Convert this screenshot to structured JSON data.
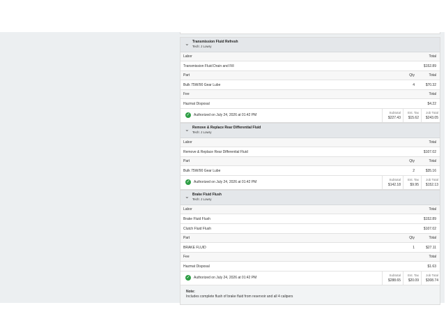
{
  "jobs": [
    {
      "title": "Transmission Fluid Refresh",
      "tech": "Tech: J Lowry",
      "labor_header": "Labor",
      "labor_total_header": "Total",
      "labor_items": [
        {
          "name": "Transmission Fluid Drain and Fill",
          "total": "$152.89"
        }
      ],
      "part_header": "Part",
      "qty_header": "Qty",
      "part_total_header": "Total",
      "part_items": [
        {
          "name": "Bulk 75W/90 Gear Lube",
          "qty": "4",
          "total": "$70.32"
        }
      ],
      "fee_header": "Fee",
      "fee_total_header": "Total",
      "fee_items": [
        {
          "name": "Hazmat Disposal",
          "total": "$4.22"
        }
      ],
      "authorized": "Authorized on July 24, 2026 at 01:42 PM",
      "subtotal_label": "Subtotal",
      "subtotal": "$227.43",
      "tax_label": "Est. Tax",
      "tax": "$15.62",
      "job_total_label": "Job Total",
      "job_total": "$243.05"
    },
    {
      "title": "Remove & Replace Rear Differential Fluid",
      "tech": "Tech: J Lowry",
      "labor_header": "Labor",
      "labor_total_header": "Total",
      "labor_items": [
        {
          "name": "Remove & Replace Rear Differential Fluid",
          "total": "$107.02"
        }
      ],
      "part_header": "Part",
      "qty_header": "Qty",
      "part_total_header": "Total",
      "part_items": [
        {
          "name": "Bulk 75W/90 Gear Lube",
          "qty": "2",
          "total": "$35.16"
        }
      ],
      "authorized": "Authorized on July 24, 2026 at 01:42 PM",
      "subtotal_label": "Subtotal",
      "subtotal": "$142.18",
      "tax_label": "Est. Tax",
      "tax": "$9.95",
      "job_total_label": "Job Total",
      "job_total": "$152.13"
    },
    {
      "title": "Brake Fluid Flush",
      "tech": "Tech: J Lowry",
      "labor_header": "Labor",
      "labor_total_header": "Total",
      "labor_items": [
        {
          "name": "Brake Fluid Flush",
          "total": "$152.89"
        },
        {
          "name": "Clutch Fluid Flush",
          "total": "$107.02"
        }
      ],
      "part_header": "Part",
      "qty_header": "Qty",
      "part_total_header": "Total",
      "part_items": [
        {
          "name": "BRAKE FLUID",
          "qty": "1",
          "total": "$27.11"
        }
      ],
      "fee_header": "Fee",
      "fee_total_header": "Total",
      "fee_items": [
        {
          "name": "Hazmat Disposal",
          "total": "$1.63"
        }
      ],
      "authorized": "Authorized on July 24, 2026 at 01:42 PM",
      "subtotal_label": "Subtotal",
      "subtotal": "$288.65",
      "tax_label": "Est. Tax",
      "tax": "$20.09",
      "job_total_label": "Job Total",
      "job_total": "$308.74",
      "note_label": "Note:",
      "note_text": "Includes complete flush of brake fluid from reservoir and all 4 calipers"
    }
  ],
  "icons": {
    "chevron": "chevron-down-icon",
    "check": "check-circle-icon"
  },
  "colors": {
    "check_green": "#2e9e45",
    "header_gray": "#e4e7ea",
    "background": "#eceff1"
  }
}
